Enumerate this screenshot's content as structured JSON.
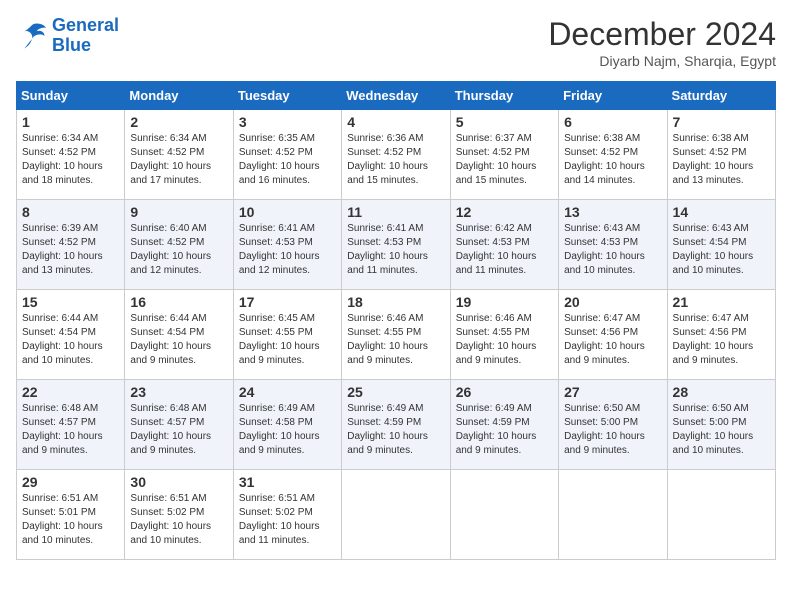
{
  "logo": {
    "line1": "General",
    "line2": "Blue"
  },
  "header": {
    "month": "December 2024",
    "location": "Diyarb Najm, Sharqia, Egypt"
  },
  "weekdays": [
    "Sunday",
    "Monday",
    "Tuesday",
    "Wednesday",
    "Thursday",
    "Friday",
    "Saturday"
  ],
  "weeks": [
    [
      {
        "day": 1,
        "sunrise": "6:34 AM",
        "sunset": "4:52 PM",
        "daylight": "10 hours and 18 minutes"
      },
      {
        "day": 2,
        "sunrise": "6:34 AM",
        "sunset": "4:52 PM",
        "daylight": "10 hours and 17 minutes"
      },
      {
        "day": 3,
        "sunrise": "6:35 AM",
        "sunset": "4:52 PM",
        "daylight": "10 hours and 16 minutes"
      },
      {
        "day": 4,
        "sunrise": "6:36 AM",
        "sunset": "4:52 PM",
        "daylight": "10 hours and 15 minutes"
      },
      {
        "day": 5,
        "sunrise": "6:37 AM",
        "sunset": "4:52 PM",
        "daylight": "10 hours and 15 minutes"
      },
      {
        "day": 6,
        "sunrise": "6:38 AM",
        "sunset": "4:52 PM",
        "daylight": "10 hours and 14 minutes"
      },
      {
        "day": 7,
        "sunrise": "6:38 AM",
        "sunset": "4:52 PM",
        "daylight": "10 hours and 13 minutes"
      }
    ],
    [
      {
        "day": 8,
        "sunrise": "6:39 AM",
        "sunset": "4:52 PM",
        "daylight": "10 hours and 13 minutes"
      },
      {
        "day": 9,
        "sunrise": "6:40 AM",
        "sunset": "4:52 PM",
        "daylight": "10 hours and 12 minutes"
      },
      {
        "day": 10,
        "sunrise": "6:41 AM",
        "sunset": "4:53 PM",
        "daylight": "10 hours and 12 minutes"
      },
      {
        "day": 11,
        "sunrise": "6:41 AM",
        "sunset": "4:53 PM",
        "daylight": "10 hours and 11 minutes"
      },
      {
        "day": 12,
        "sunrise": "6:42 AM",
        "sunset": "4:53 PM",
        "daylight": "10 hours and 11 minutes"
      },
      {
        "day": 13,
        "sunrise": "6:43 AM",
        "sunset": "4:53 PM",
        "daylight": "10 hours and 10 minutes"
      },
      {
        "day": 14,
        "sunrise": "6:43 AM",
        "sunset": "4:54 PM",
        "daylight": "10 hours and 10 minutes"
      }
    ],
    [
      {
        "day": 15,
        "sunrise": "6:44 AM",
        "sunset": "4:54 PM",
        "daylight": "10 hours and 10 minutes"
      },
      {
        "day": 16,
        "sunrise": "6:44 AM",
        "sunset": "4:54 PM",
        "daylight": "10 hours and 9 minutes"
      },
      {
        "day": 17,
        "sunrise": "6:45 AM",
        "sunset": "4:55 PM",
        "daylight": "10 hours and 9 minutes"
      },
      {
        "day": 18,
        "sunrise": "6:46 AM",
        "sunset": "4:55 PM",
        "daylight": "10 hours and 9 minutes"
      },
      {
        "day": 19,
        "sunrise": "6:46 AM",
        "sunset": "4:55 PM",
        "daylight": "10 hours and 9 minutes"
      },
      {
        "day": 20,
        "sunrise": "6:47 AM",
        "sunset": "4:56 PM",
        "daylight": "10 hours and 9 minutes"
      },
      {
        "day": 21,
        "sunrise": "6:47 AM",
        "sunset": "4:56 PM",
        "daylight": "10 hours and 9 minutes"
      }
    ],
    [
      {
        "day": 22,
        "sunrise": "6:48 AM",
        "sunset": "4:57 PM",
        "daylight": "10 hours and 9 minutes"
      },
      {
        "day": 23,
        "sunrise": "6:48 AM",
        "sunset": "4:57 PM",
        "daylight": "10 hours and 9 minutes"
      },
      {
        "day": 24,
        "sunrise": "6:49 AM",
        "sunset": "4:58 PM",
        "daylight": "10 hours and 9 minutes"
      },
      {
        "day": 25,
        "sunrise": "6:49 AM",
        "sunset": "4:59 PM",
        "daylight": "10 hours and 9 minutes"
      },
      {
        "day": 26,
        "sunrise": "6:49 AM",
        "sunset": "4:59 PM",
        "daylight": "10 hours and 9 minutes"
      },
      {
        "day": 27,
        "sunrise": "6:50 AM",
        "sunset": "5:00 PM",
        "daylight": "10 hours and 9 minutes"
      },
      {
        "day": 28,
        "sunrise": "6:50 AM",
        "sunset": "5:00 PM",
        "daylight": "10 hours and 10 minutes"
      }
    ],
    [
      {
        "day": 29,
        "sunrise": "6:51 AM",
        "sunset": "5:01 PM",
        "daylight": "10 hours and 10 minutes"
      },
      {
        "day": 30,
        "sunrise": "6:51 AM",
        "sunset": "5:02 PM",
        "daylight": "10 hours and 10 minutes"
      },
      {
        "day": 31,
        "sunrise": "6:51 AM",
        "sunset": "5:02 PM",
        "daylight": "10 hours and 11 minutes"
      },
      null,
      null,
      null,
      null
    ]
  ]
}
